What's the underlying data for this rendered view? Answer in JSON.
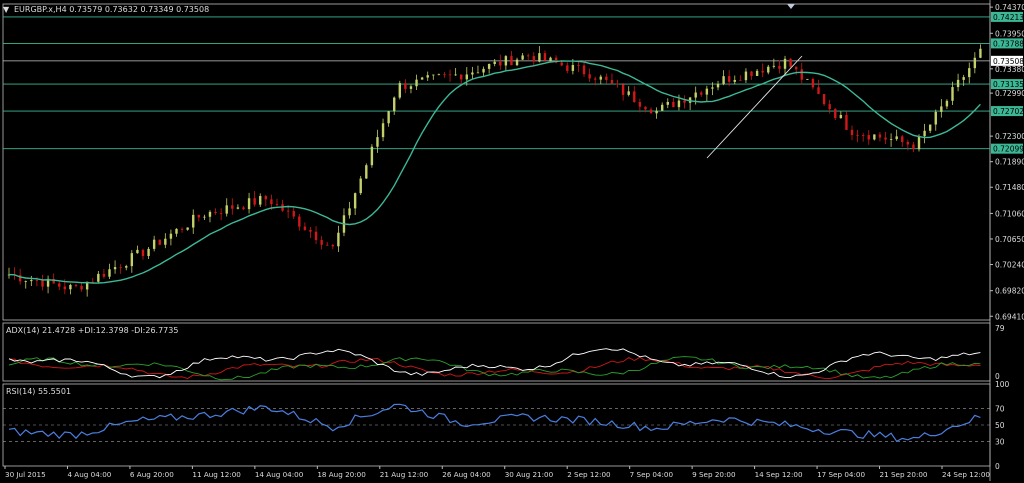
{
  "header": {
    "symbol_line": "EURGBP.x,H4  0.73579 0.73632 0.73349 0.73508",
    "menu_arrow": "▼"
  },
  "price_axis": {
    "ticks": [
      "0.74370",
      "0.73950",
      "0.73380",
      "0.72990",
      "0.72300",
      "0.71890",
      "0.71480",
      "0.71060",
      "0.70650",
      "0.70240",
      "0.69820",
      "0.69410"
    ],
    "tick_values": [
      0.7437,
      0.7395,
      0.7338,
      0.7299,
      0.723,
      0.7189,
      0.7148,
      0.7106,
      0.7065,
      0.7024,
      0.6982,
      0.6941
    ],
    "range": [
      0.6935,
      0.7442
    ]
  },
  "levels": [
    {
      "label": "0.74213",
      "value": 0.74213
    },
    {
      "label": "0.73788",
      "value": 0.73788
    },
    {
      "label": "0.73508",
      "value": 0.73508
    },
    {
      "label": "0.73135",
      "value": 0.73135
    },
    {
      "label": "0.72702",
      "value": 0.72702
    },
    {
      "label": "0.72099",
      "value": 0.72099
    }
  ],
  "current_price_label": "0.73508",
  "time_axis": {
    "labels": [
      "30 Jul 2015",
      "4 Aug 04:00",
      "6 Aug 20:00",
      "11 Aug 12:00",
      "14 Aug 04:00",
      "18 Aug 20:00",
      "21 Aug 12:00",
      "26 Aug 04:00",
      "30 Aug 21:00",
      "2 Sep 12:00",
      "7 Sep 04:00",
      "9 Sep 20:00",
      "14 Sep 12:00",
      "17 Sep 04:00",
      "21 Sep 20:00",
      "24 Sep 12:00"
    ]
  },
  "adx": {
    "title": "ADX(14) 21.4728 +DI:12.3798 -DI:26.7735",
    "max_label": "79",
    "min_label": "0"
  },
  "rsi": {
    "title": "RSI(14) 55.5501",
    "ticks": [
      "100",
      "70",
      "50",
      "30",
      "0"
    ],
    "tick_values": [
      100,
      70,
      50,
      30,
      0
    ]
  },
  "colors": {
    "bull": "#c4d06a",
    "bear": "#d01818",
    "ma": "#3cb896",
    "level": "#3cb896",
    "adx": "#ffffff",
    "plus_di": "#2aa02a",
    "minus_di": "#d01818",
    "rsi": "#4a7fe0",
    "grid": "#a0a0a0"
  },
  "chart_data": {
    "type": "line",
    "title": "EURGBP.x,H4  0.73579 0.73632 0.73349 0.73508",
    "xlabel": "",
    "ylabel": "",
    "x": [
      "30 Jul 2015",
      "4 Aug 04:00",
      "6 Aug 20:00",
      "11 Aug 12:00",
      "14 Aug 04:00",
      "18 Aug 20:00",
      "21 Aug 12:00",
      "26 Aug 04:00",
      "30 Aug 21:00",
      "2 Sep 12:00",
      "7 Sep 04:00",
      "9 Sep 20:00",
      "14 Sep 12:00",
      "17 Sep 04:00",
      "21 Sep 20:00",
      "24 Sep 12:00"
    ],
    "ylim": [
      0.6935,
      0.7442
    ],
    "series": [
      {
        "values": [
          0.7008,
          0.6985,
          0.704,
          0.7105,
          0.713,
          0.705,
          0.731,
          0.733,
          0.736,
          0.733,
          0.727,
          0.732,
          0.735,
          0.724,
          0.7215,
          0.7365
        ]
      }
    ],
    "rsi_values": [
      42,
      38,
      55,
      62,
      72,
      48,
      75,
      52,
      60,
      55,
      46,
      58,
      50,
      40,
      33,
      60
    ],
    "adx_panel": {
      "ylim": [
        0,
        79
      ]
    },
    "rsi_panel": {
      "ylim": [
        0,
        100
      ]
    }
  }
}
